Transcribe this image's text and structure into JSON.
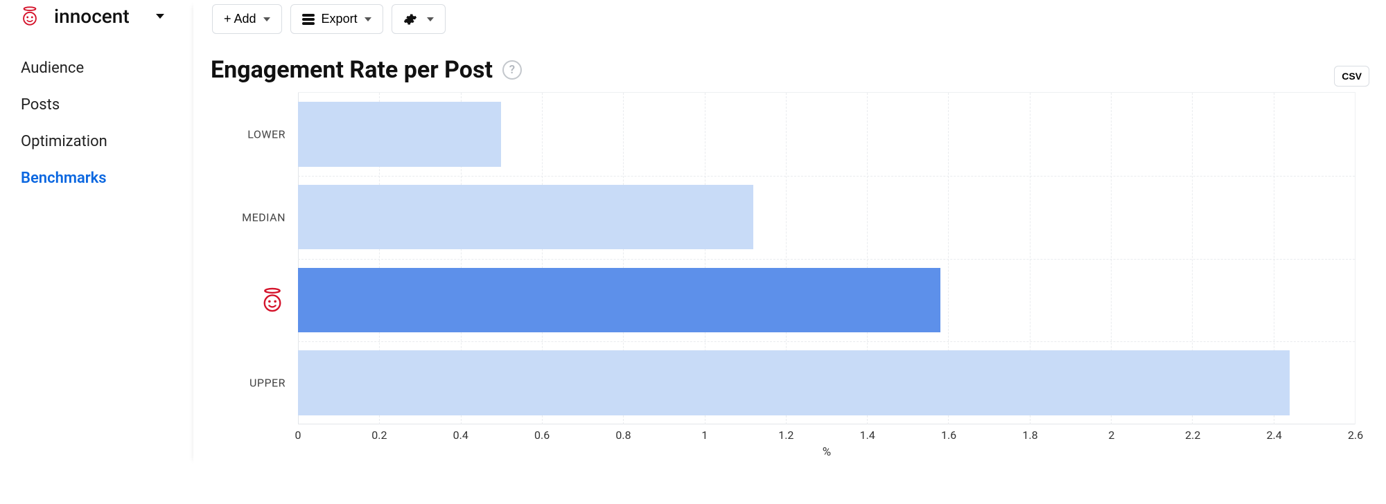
{
  "brand": {
    "name": "innocent",
    "icon": "angel-icon"
  },
  "toolbar": {
    "add_label": "+ Add",
    "export_label": "Export",
    "settings_icon": "gear-icon",
    "csv_label": "CSV"
  },
  "sidebar": {
    "items": [
      {
        "label": "Audience",
        "active": false
      },
      {
        "label": "Posts",
        "active": false
      },
      {
        "label": "Optimization",
        "active": false
      },
      {
        "label": "Benchmarks",
        "active": true
      }
    ]
  },
  "page": {
    "title": "Engagement Rate per Post",
    "help": "?"
  },
  "chart_data": {
    "type": "bar",
    "orientation": "horizontal",
    "title": "Engagement Rate per Post",
    "xlabel": "%",
    "ylabel": "",
    "xlim": [
      0,
      2.6
    ],
    "x_ticks": [
      0,
      0.2,
      0.4,
      0.6,
      0.8,
      1,
      1.2,
      1.4,
      1.6,
      1.8,
      2,
      2.2,
      2.4,
      2.6
    ],
    "categories": [
      "LOWER",
      "MEDIAN",
      "INNOCENT",
      "UPPER"
    ],
    "category_display": [
      {
        "kind": "text",
        "label": "LOWER"
      },
      {
        "kind": "text",
        "label": "MEDIAN"
      },
      {
        "kind": "icon",
        "icon": "angel-icon"
      },
      {
        "kind": "text",
        "label": "UPPER"
      }
    ],
    "values": [
      0.5,
      1.12,
      1.58,
      2.44
    ],
    "colors": [
      "#c8dbf7",
      "#c8dbf7",
      "#5d90ea",
      "#c8dbf7"
    ],
    "highlight_index": 2
  }
}
